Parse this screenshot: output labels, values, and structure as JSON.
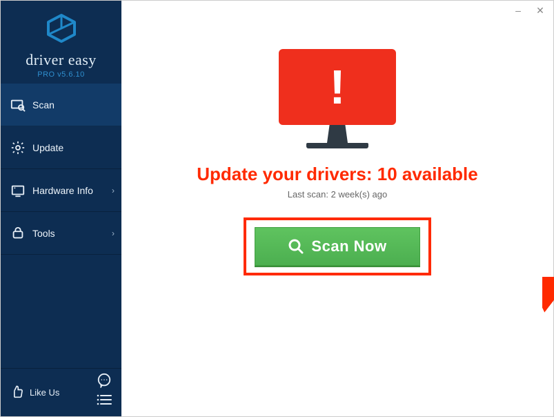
{
  "app": {
    "name": "driver easy",
    "edition": "PRO",
    "version": "v5.6.10"
  },
  "sidebar": {
    "items": [
      {
        "label": "Scan",
        "icon": "scan-icon",
        "active": true,
        "has_submenu": false
      },
      {
        "label": "Update",
        "icon": "gear-icon",
        "active": false,
        "has_submenu": false
      },
      {
        "label": "Hardware Info",
        "icon": "hardware-icon",
        "active": false,
        "has_submenu": true
      },
      {
        "label": "Tools",
        "icon": "tools-icon",
        "active": false,
        "has_submenu": true
      }
    ],
    "footer": {
      "like_label": "Like Us",
      "chat_icon": "chat-icon",
      "menu_icon": "hamburger-icon"
    }
  },
  "main": {
    "headline": "Update your drivers: 10 available",
    "subline": "Last scan: 2 week(s) ago",
    "scan_button_label": "Scan Now",
    "alert_icon": "monitor-alert-icon"
  },
  "window_controls": {
    "minimize": "–",
    "close": "✕"
  },
  "colors": {
    "sidebar_bg": "#0d2d52",
    "accent_red": "#ff2a00",
    "alert_red": "#ef2f1d",
    "scan_green": "#4caf50",
    "logo_blue": "#1f88c9"
  }
}
